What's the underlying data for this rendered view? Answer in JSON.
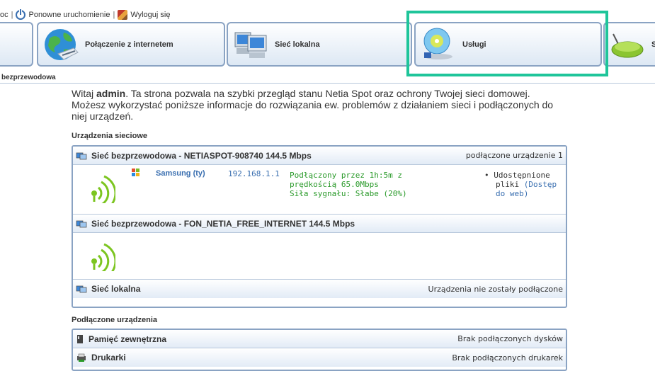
{
  "toplinks": {
    "help_partial": "oc",
    "separator": "|",
    "restart": "Ponowne uruchomienie",
    "logout": "Wyloguj się"
  },
  "tabs": [
    {
      "label": "",
      "icon": "tab-partial-icon"
    },
    {
      "label": "Połączenie z internetem",
      "icon": "globe-icon"
    },
    {
      "label": "Sieć lokalna",
      "icon": "computers-icon"
    },
    {
      "label": "Usługi",
      "icon": "disc-icon"
    },
    {
      "label": "S",
      "icon": "router-icon"
    }
  ],
  "subnav": {
    "active": "bezprzewodowa"
  },
  "intro": {
    "greeting": "Witaj ",
    "user": "admin",
    "text1": ". Ta strona pozwala na szybki przegląd stanu Netia Spot oraz ochrony Twojej sieci domowej.",
    "text2": "Możesz wykorzystać poniższe informacje do rozwiązania ew. problemów z działaniem sieci i podłączonych do niej urządzeń."
  },
  "network_section": {
    "title": "Urządzenia sieciowe",
    "wireless1": {
      "name": "Sieć bezprzewodowa - NETIASPOT-908740 144.5 Mbps",
      "count": "podłączone urządzenie 1",
      "device": {
        "name": "Samsung (ty)",
        "ip": "192.168.1.1",
        "status1": "Podłączony przez 1h:5m z",
        "status2": "prędkością 65.0Mbps",
        "status3": "Siła sygnału: Słabe (20%)",
        "share_bullet": "•",
        "share1": "Udostępnione",
        "share2": "pliki",
        "share_link1": "(Dostęp",
        "share_link2": "do web)"
      }
    },
    "wireless2": {
      "name": "Sieć bezprzewodowa - FON_NETIA_FREE_INTERNET 144.5 Mbps"
    },
    "local": {
      "name": "Sieć lokalna",
      "status": "Urządzenia nie zostały podłączone"
    }
  },
  "connected_section": {
    "title": "Podłączone urządzenia",
    "storage": {
      "name": "Pamięć zewnętrzna",
      "status": "Brak podłączonych dysków"
    },
    "printers": {
      "name": "Drukarki",
      "status": "Brak podłączonych drukarek"
    }
  },
  "colors": {
    "accent": "#3a6fb0",
    "border": "#8aa3c3",
    "highlight": "#1fc59a",
    "status_green": "#2a9a2a"
  }
}
